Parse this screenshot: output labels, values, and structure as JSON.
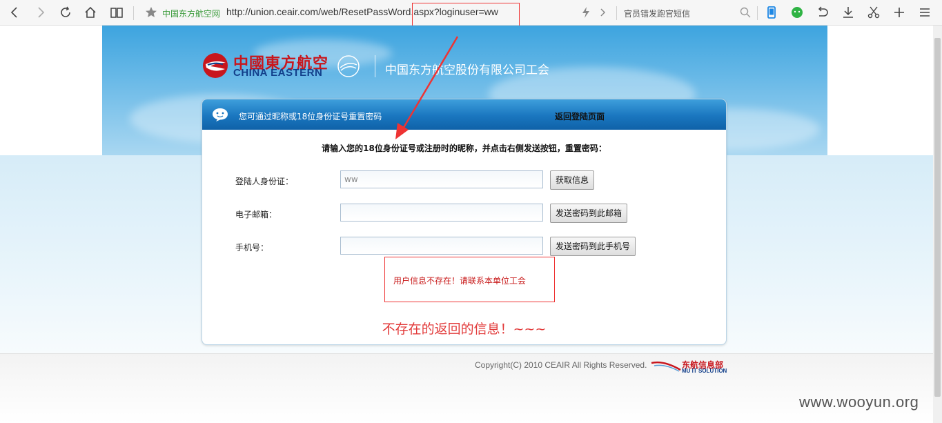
{
  "browser": {
    "site_name": "中国东方航空网",
    "url": "http://union.ceair.com/web/ResetPassWord.aspx?loginuser=ww",
    "search_text": "官员错发跑官短信"
  },
  "brand": {
    "logo_cn": "中國東方航空",
    "logo_en": "CHINA EASTERN",
    "company_name": "中国东方航空股份有限公司工会"
  },
  "panel": {
    "tip": "您可通过昵称或18位身份证号重置密码",
    "back_login": "返回登陆页面",
    "instruction": "请输入您的18位身份证号或注册时的昵称，并点击右侧发送按钮，重置密码：",
    "id_label": "登陆人身份证：",
    "id_value": "ww",
    "get_info_button": "获取信息",
    "email_label": "电子邮箱：",
    "email_value": "",
    "send_email_button": "发送密码到此邮箱",
    "phone_label": "手机号：",
    "phone_value": "",
    "send_phone_button": "发送密码到此手机号",
    "error_message": "用户信息不存在！请联系本单位工会"
  },
  "annotation": "不存在的返回的信息！~~~",
  "footer": {
    "copyright": "Copyright(C) 2010 CEAIR All Rights Reserved.",
    "mu_cn": "东航信息部",
    "mu_en": "MU IT SOLUTION"
  },
  "watermark": "www.wooyun.org",
  "colors": {
    "brand_red": "#c8161d",
    "brand_blue": "#123f8a",
    "annotation_red": "#e23a3a",
    "panel_header_blue": "#1a76bf"
  }
}
